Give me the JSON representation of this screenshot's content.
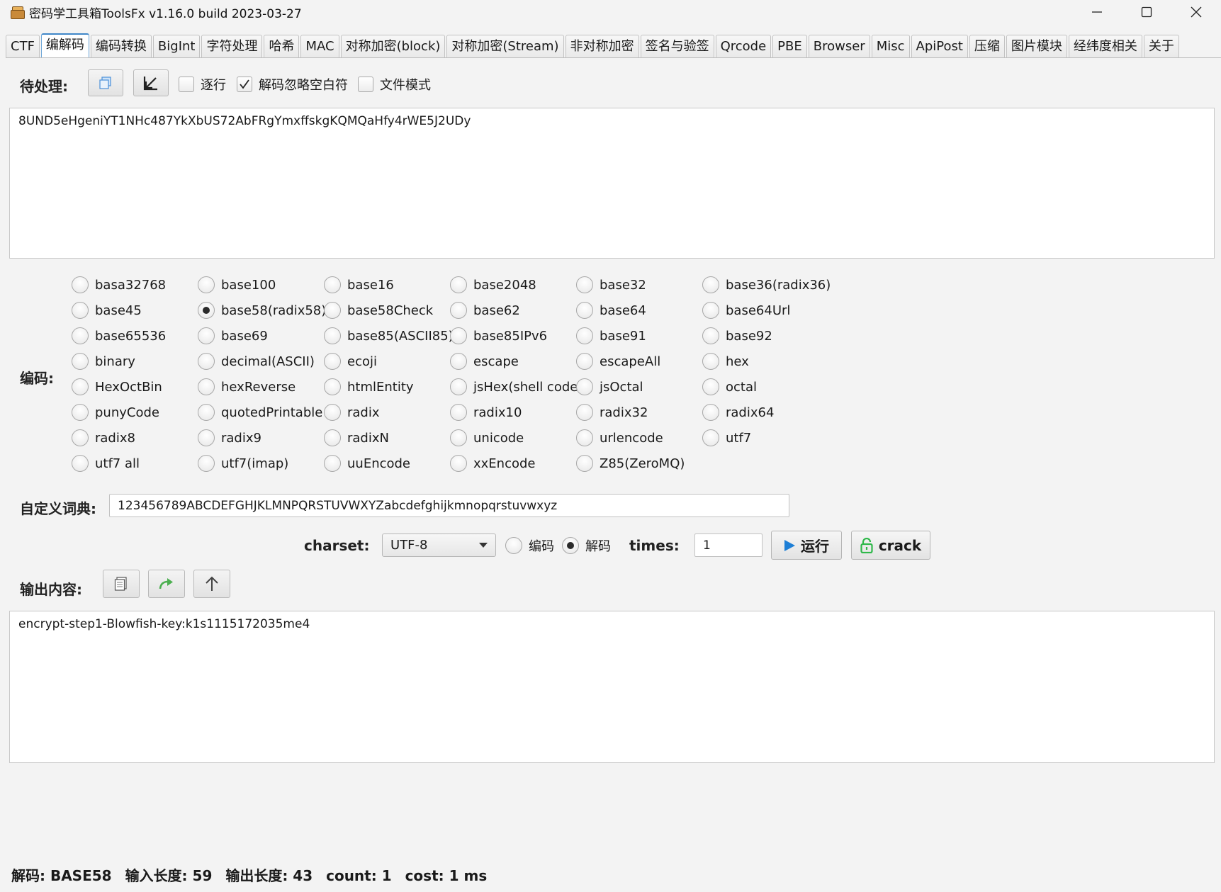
{
  "window": {
    "title": "密码学工具箱ToolsFx v1.16.0 build 2023-03-27"
  },
  "tabs": [
    {
      "label": "CTF",
      "active": false
    },
    {
      "label": "编解码",
      "active": true
    },
    {
      "label": "编码转换",
      "active": false
    },
    {
      "label": "BigInt",
      "active": false
    },
    {
      "label": "字符处理",
      "active": false
    },
    {
      "label": "哈希",
      "active": false
    },
    {
      "label": "MAC",
      "active": false
    },
    {
      "label": "对称加密(block)",
      "active": false
    },
    {
      "label": "对称加密(Stream)",
      "active": false
    },
    {
      "label": "非对称加密",
      "active": false
    },
    {
      "label": "签名与验签",
      "active": false
    },
    {
      "label": "Qrcode",
      "active": false
    },
    {
      "label": "PBE",
      "active": false
    },
    {
      "label": "Browser",
      "active": false
    },
    {
      "label": "Misc",
      "active": false
    },
    {
      "label": "ApiPost",
      "active": false
    },
    {
      "label": "压缩",
      "active": false
    },
    {
      "label": "图片模块",
      "active": false
    },
    {
      "label": "经纬度相关",
      "active": false
    },
    {
      "label": "关于",
      "active": false
    }
  ],
  "input_section": {
    "label": "待处理:",
    "checkbox_line_by_line": {
      "label": "逐行",
      "checked": false
    },
    "checkbox_ignore_whitespace": {
      "label": "解码忽略空白符",
      "checked": true
    },
    "checkbox_file_mode": {
      "label": "文件模式",
      "checked": false
    },
    "value": "8UND5eHgeniYT1NHc487YkXbUS72AbFRgYmxffskgKQMQaHfy4rWE5J2UDy"
  },
  "encoding_section": {
    "label": "编码:",
    "selected": "base58(radix58)",
    "options": [
      "basa32768",
      "base100",
      "base16",
      "base2048",
      "base32",
      "base36(radix36)",
      "base45",
      "base58(radix58)",
      "base58Check",
      "base62",
      "base64",
      "base64Url",
      "base65536",
      "base69",
      "base85(ASCII85)",
      "base85IPv6",
      "base91",
      "base92",
      "binary",
      "decimal(ASCII)",
      "ecoji",
      "escape",
      "escapeAll",
      "hex",
      "HexOctBin",
      "hexReverse",
      "htmlEntity",
      "jsHex(shell code)",
      "jsOctal",
      "octal",
      "punyCode",
      "quotedPrintable",
      "radix",
      "radix10",
      "radix32",
      "radix64",
      "radix8",
      "radix9",
      "radixN",
      "unicode",
      "urlencode",
      "utf7",
      "utf7 all",
      "utf7(imap)",
      "uuEncode",
      "xxEncode",
      "Z85(ZeroMQ)"
    ]
  },
  "dictionary": {
    "label": "自定义词典:",
    "value": "123456789ABCDEFGHJKLMNPQRSTUVWXYZabcdefghijkmnopqrstuvwxyz"
  },
  "controls": {
    "charset_label": "charset:",
    "charset_value": "UTF-8",
    "mode_encode_label": "编码",
    "mode_decode_label": "解码",
    "mode_selected": "解码",
    "times_label": "times:",
    "times_value": "1",
    "run_label": "运行",
    "crack_label": "crack"
  },
  "output_section": {
    "label": "输出内容:",
    "value": "encrypt-step1-Blowfish-key:k1s1115172035me4"
  },
  "status": {
    "mode": "解码: BASE58",
    "input_length": "输入长度: 59",
    "output_length": "输出长度: 43",
    "count": "count: 1",
    "cost": "cost: 1 ms"
  },
  "colors": {
    "background": "#f3f3f3",
    "active_tab_border": "#3f86c8",
    "run_icon": "#1e7fd6",
    "crack_icon": "#2fb84a",
    "forward_icon": "#4caf50"
  }
}
